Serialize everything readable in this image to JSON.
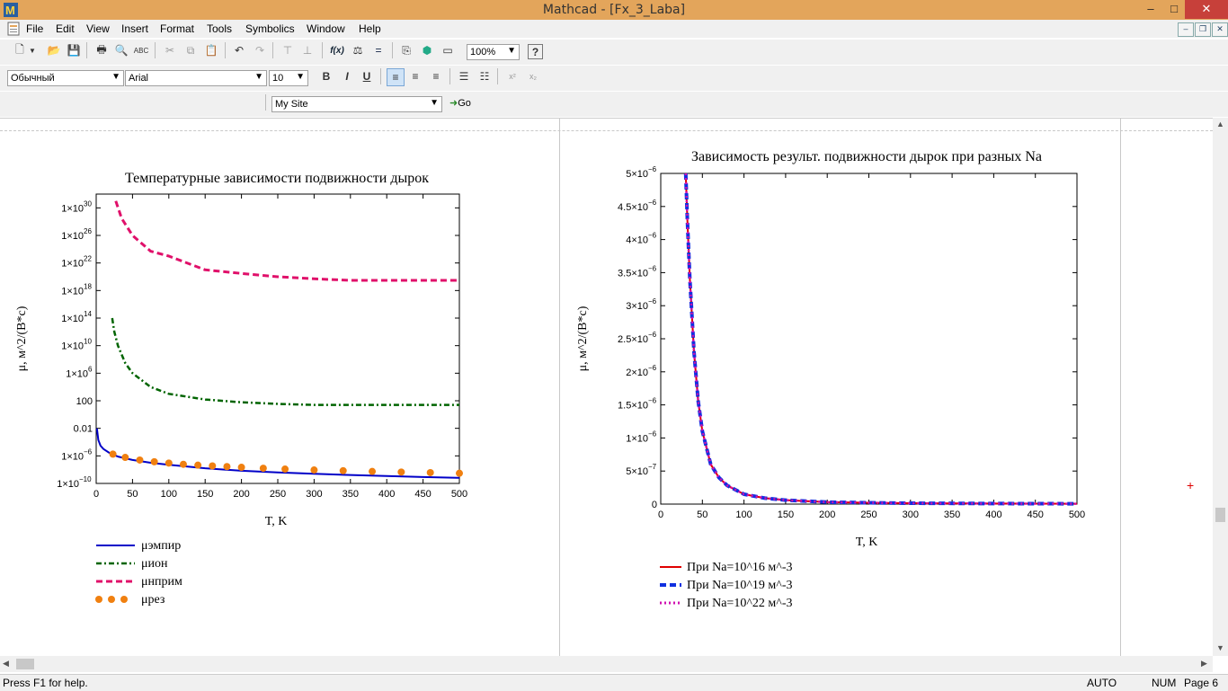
{
  "window": {
    "title": "Mathcad - [Fx_3_Laba]",
    "min": "–",
    "max": "□",
    "close": "✕"
  },
  "menu": [
    "File",
    "Edit",
    "View",
    "Insert",
    "Format",
    "Tools",
    "Symbolics",
    "Window",
    "Help"
  ],
  "toolbar": {
    "zoom": "100%",
    "style": "Обычный",
    "font": "Arial",
    "size": "10",
    "bold": "B",
    "italic": "I",
    "underline": "U",
    "site": "My Site",
    "go": "Go",
    "func_icon": "f(x)"
  },
  "status": {
    "help": "Press F1 for help.",
    "mode": "AUTO",
    "num": "NUM",
    "page": "Page 6"
  },
  "plot1": {
    "title": "Температурные зависимости подвижности дырок",
    "xlabel": "T, K",
    "ylabel": "μ, м^2/(В*с)",
    "xticks": [
      "0",
      "50",
      "100",
      "150",
      "200",
      "250",
      "300",
      "350",
      "400",
      "450",
      "500"
    ],
    "yticks": [
      {
        "m": "1×10",
        "e": "−10"
      },
      {
        "m": "1×10",
        "e": "−6"
      },
      {
        "m": "0.01",
        "e": ""
      },
      {
        "m": "100",
        "e": ""
      },
      {
        "m": "1×10",
        "e": "6"
      },
      {
        "m": "1×10",
        "e": "10"
      },
      {
        "m": "1×10",
        "e": "14"
      },
      {
        "m": "1×10",
        "e": "18"
      },
      {
        "m": "1×10",
        "e": "22"
      },
      {
        "m": "1×10",
        "e": "26"
      },
      {
        "m": "1×10",
        "e": "30"
      }
    ],
    "legend": [
      "μэмпир",
      "μион",
      "μнприм",
      "μрез"
    ],
    "colors": [
      "#0000c8",
      "#006400",
      "#e0106a",
      "#f08010"
    ]
  },
  "plot2": {
    "title": "Зависимость результ. подвижности дырок при разных Na",
    "xlabel": "T, K",
    "ylabel": "μ, м^2/(В*с)",
    "xticks": [
      "0",
      "50",
      "100",
      "150",
      "200",
      "250",
      "300",
      "350",
      "400",
      "450",
      "500"
    ],
    "yticks": [
      {
        "m": "0",
        "e": ""
      },
      {
        "m": "5×10",
        "e": "−7"
      },
      {
        "m": "1×10",
        "e": "−6"
      },
      {
        "m": "1.5×10",
        "e": "−6"
      },
      {
        "m": "2×10",
        "e": "−6"
      },
      {
        "m": "2.5×10",
        "e": "−6"
      },
      {
        "m": "3×10",
        "e": "−6"
      },
      {
        "m": "3.5×10",
        "e": "−6"
      },
      {
        "m": "4×10",
        "e": "−6"
      },
      {
        "m": "4.5×10",
        "e": "−6"
      },
      {
        "m": "5×10",
        "e": "−6"
      }
    ],
    "legend": [
      "При Na=10^16 м^-3",
      "При Na=10^19 м^-3",
      "При Na=10^22 м^-3"
    ],
    "colors": [
      "#e00000",
      "#1030e0",
      "#d010b0"
    ]
  },
  "chart_data": [
    {
      "type": "line",
      "title": "Температурные зависимости подвижности дырок",
      "xlabel": "T, K",
      "ylabel": "μ, м^2/(В*с)",
      "xlim": [
        0,
        500
      ],
      "ylim": [
        1e-10,
        1e+32
      ],
      "yscale": "log",
      "series": [
        {
          "name": "μэмпир",
          "x": [
            1,
            3,
            6,
            10,
            20,
            30,
            50,
            75,
            100,
            150,
            200,
            250,
            300,
            350,
            400,
            450,
            500
          ],
          "y": [
            0.01,
            0.0002,
            3e-05,
            1e-05,
            2e-06,
            8e-07,
            2.5e-07,
            1e-07,
            5e-08,
            1.6e-08,
            7e-09,
            4e-09,
            2.5e-09,
            1.7e-09,
            1.2e-09,
            8.5e-10,
            6.5e-10
          ]
        },
        {
          "name": "μион",
          "x": [
            22,
            25,
            30,
            40,
            50,
            75,
            100,
            150,
            200,
            250,
            300,
            350,
            400,
            450,
            500
          ],
          "y": [
            100000000000000.0,
            1000000000000.0,
            10000000000.0,
            30000000.0,
            1000000.0,
            10000.0,
            1000.0,
            150,
            60,
            35,
            25,
            25,
            25,
            25,
            25
          ]
        },
        {
          "name": "μнприм",
          "x": [
            27,
            35,
            50,
            75,
            100,
            150,
            200,
            250,
            300,
            350,
            400,
            450,
            500
          ],
          "y": [
            1e+31,
            3e+28,
            1e+26,
            5e+23,
            1e+23,
            1e+21,
            3e+20,
            1e+20,
            5e+19,
            3e+19,
            3e+19,
            3e+19,
            3e+19
          ]
        },
        {
          "name": "μрез",
          "x": [
            23,
            40,
            60,
            80,
            100,
            120,
            140,
            160,
            180,
            200,
            230,
            260,
            300,
            340,
            380,
            420,
            460,
            500
          ],
          "y": [
            1.8e-06,
            6e-07,
            2.5e-07,
            1.4e-07,
            9e-08,
            6e-08,
            4.5e-08,
            3.5e-08,
            2.8e-08,
            2.2e-08,
            1.6e-08,
            1.2e-08,
            9e-09,
            7e-09,
            5.5e-09,
            4.5e-09,
            3.7e-09,
            3e-09
          ]
        }
      ]
    },
    {
      "type": "line",
      "title": "Зависимость результ. подвижности дырок при разных Na",
      "xlabel": "T, K",
      "ylabel": "μ, м^2/(В*с)",
      "xlim": [
        0,
        500
      ],
      "ylim": [
        0,
        5e-06
      ],
      "series": [
        {
          "name": "При Na=10^16 м^-3",
          "x": [
            30,
            32,
            35,
            40,
            45,
            50,
            60,
            70,
            80,
            100,
            125,
            150,
            200,
            250,
            300,
            400,
            500
          ],
          "y": [
            5e-06,
            4.3e-06,
            3.4e-06,
            2.3e-06,
            1.55e-06,
            1.1e-06,
            6e-07,
            4e-07,
            2.8e-07,
            1.5e-07,
            9e-08,
            6e-08,
            3e-08,
            2e-08,
            1.4e-08,
            8e-09,
            5e-09
          ]
        },
        {
          "name": "При Na=10^19 м^-3",
          "x": [
            30,
            32,
            35,
            40,
            45,
            50,
            60,
            70,
            80,
            100,
            125,
            150,
            200,
            250,
            300,
            400,
            500
          ],
          "y": [
            5e-06,
            4.3e-06,
            3.4e-06,
            2.3e-06,
            1.55e-06,
            1.1e-06,
            6e-07,
            4e-07,
            2.8e-07,
            1.5e-07,
            9e-08,
            6e-08,
            3e-08,
            2e-08,
            1.4e-08,
            8e-09,
            5e-09
          ]
        },
        {
          "name": "При Na=10^22 м^-3",
          "x": [
            30,
            32,
            35,
            40,
            45,
            50,
            60,
            70,
            80,
            100,
            125,
            150,
            200,
            250,
            300,
            400,
            500
          ],
          "y": [
            5e-06,
            4.3e-06,
            3.4e-06,
            2.3e-06,
            1.55e-06,
            1.1e-06,
            6e-07,
            4e-07,
            2.8e-07,
            1.5e-07,
            9e-08,
            6e-08,
            3e-08,
            2e-08,
            1.4e-08,
            8e-09,
            5e-09
          ]
        }
      ]
    }
  ]
}
